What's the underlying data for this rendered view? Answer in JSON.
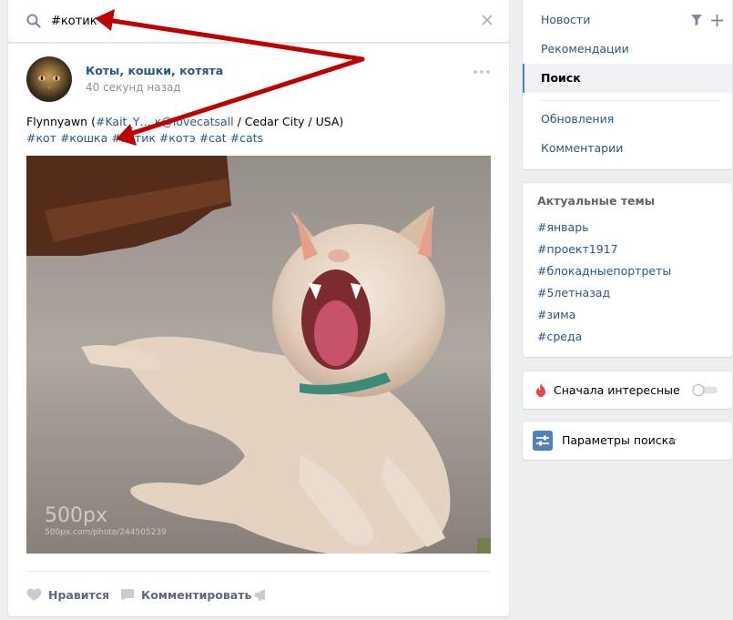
{
  "search": {
    "value": "#котик",
    "icon": "search-icon",
    "clear_icon": "close-icon"
  },
  "post": {
    "group_name": "Коты, кошки, котята",
    "time": "40 секунд назад",
    "text_line1_prefix": "Flynnyawn (",
    "text_line1_link": "#Kait_Y… к@lovecatsall",
    "text_line1_suffix": " / Cedar City / USA)",
    "hashtags": [
      "#кот",
      "#кошка",
      "#котик",
      "#котэ",
      "#cat",
      "#cats"
    ],
    "photo_watermark_logo": "500px",
    "photo_watermark_url": "500px.com/photo/244505239",
    "actions": {
      "like_label": "Нравится",
      "comment_label": "Комментировать"
    }
  },
  "menu": {
    "items": [
      {
        "label": "Новости"
      },
      {
        "label": "Рекомендации"
      },
      {
        "label": "Поиск"
      },
      {
        "label": "Обновления"
      },
      {
        "label": "Комментарии"
      }
    ],
    "active_index": 2
  },
  "topics": {
    "title": "Актуальные темы",
    "items": [
      "#январь",
      "#проект1917",
      "#блокадныепортреты",
      "#5летназад",
      "#зима",
      "#среда"
    ]
  },
  "interesting": {
    "label": "Сначала интересные",
    "enabled": false
  },
  "params": {
    "label": "Параметры поиска"
  },
  "colors": {
    "link": "#2a5885",
    "accent": "#5181b8",
    "background": "#edeef0",
    "annotation_arrow": "#c00000"
  }
}
